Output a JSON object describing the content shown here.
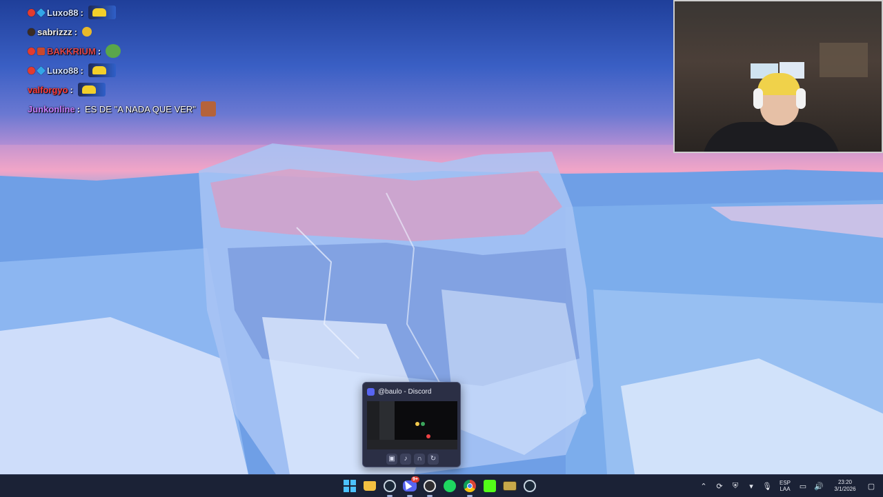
{
  "chat": {
    "lines": [
      {
        "user": "Luxo88",
        "separator": ":",
        "message": "",
        "color": "#d6e4ff",
        "badges": [
          "red",
          "cube"
        ],
        "emote": "car"
      },
      {
        "user": "sabrizzz",
        "separator": ":",
        "message": "",
        "color": "#f2f2f2",
        "badges": [
          "dark"
        ],
        "emote": "smile"
      },
      {
        "user": "BAKKRIUM",
        "separator": ":",
        "message": "",
        "color": "#e0464a",
        "badges": [
          "red",
          "gift"
        ],
        "emote": "frog"
      },
      {
        "user": "Luxo88",
        "separator": ":",
        "message": "",
        "color": "#d6e4ff",
        "badges": [
          "red",
          "cube"
        ],
        "emote": "car"
      },
      {
        "user": "valforgyo",
        "separator": ":",
        "message": "",
        "color": "#ff3b3b",
        "badges": [],
        "emote": "car"
      },
      {
        "user": "Junkonline",
        "separator": ":",
        "message": "ES DE \"A NADA QUE VER\"",
        "color": "#c77dff",
        "badges": [],
        "emote": "face"
      }
    ]
  },
  "preview": {
    "title": "@baulo - Discord",
    "icon": "discord-icon",
    "controls": [
      {
        "name": "camera-button",
        "glyph": "▣"
      },
      {
        "name": "mic-button",
        "glyph": "♪"
      },
      {
        "name": "headphones-button",
        "glyph": "∩"
      },
      {
        "name": "end-call-button",
        "glyph": "↻"
      }
    ]
  },
  "taskbar": {
    "apps": [
      {
        "name": "start-button",
        "kind": "win"
      },
      {
        "name": "file-explorer-icon",
        "kind": "folder"
      },
      {
        "name": "steam-icon",
        "kind": "steam"
      },
      {
        "name": "discord-icon",
        "kind": "discord",
        "badge": "9+"
      },
      {
        "name": "obs-icon",
        "kind": "obs"
      },
      {
        "name": "spotify-icon",
        "kind": "spotify"
      },
      {
        "name": "chrome-icon",
        "kind": "chrome"
      },
      {
        "name": "kick-icon",
        "kind": "kick"
      },
      {
        "name": "game-icon",
        "kind": "game"
      },
      {
        "name": "steam-icon-2",
        "kind": "steam"
      }
    ],
    "tray": {
      "lang_top": "ESP",
      "lang_bottom": "LAA",
      "time": "23:20",
      "date": "3/1/2026"
    }
  }
}
